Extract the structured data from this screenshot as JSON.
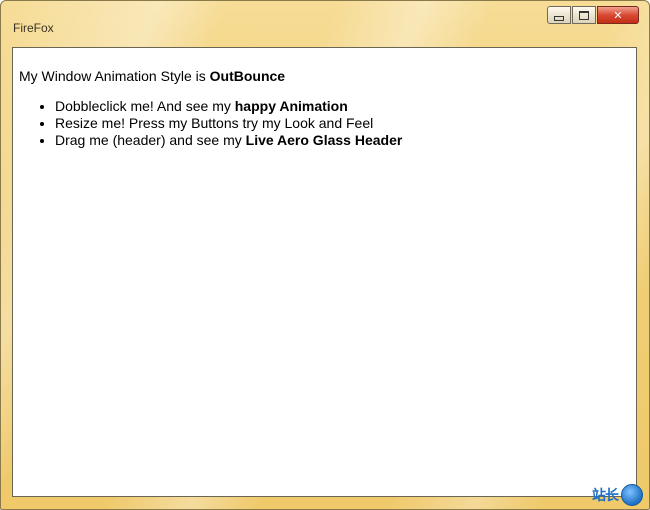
{
  "window": {
    "title": "FireFox",
    "controls": {
      "minimize_icon": "minimize-icon",
      "maximize_icon": "maximize-icon",
      "close_icon": "close-icon",
      "close_glyph": "✕"
    },
    "accent": "#d94a33",
    "frame_color": "#f1cf78"
  },
  "content": {
    "intro_prefix": "My Window Animation Style is ",
    "intro_bold": "OutBounce",
    "items": [
      {
        "text": "Dobbleclick me! And see my ",
        "bold": "happy Animation"
      },
      {
        "text": "Resize me! Press my Buttons try my Look and Feel",
        "bold": ""
      },
      {
        "text": "Drag me (header) and see my ",
        "bold": "Live Aero Glass Header"
      }
    ]
  },
  "watermark": {
    "text": "站长",
    "icon": "logo-circle-icon"
  }
}
